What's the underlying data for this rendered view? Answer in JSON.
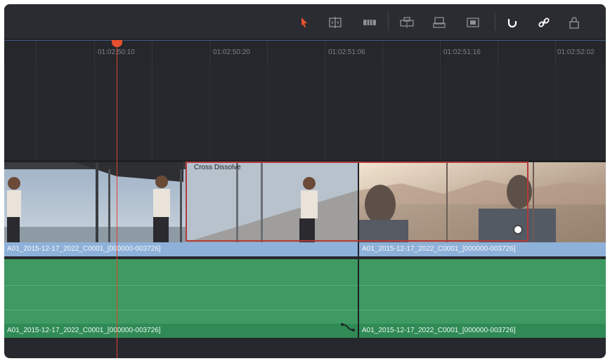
{
  "toolbar": {
    "icons": [
      "selection-pointer-icon",
      "trim-edit-icon",
      "dynamic-trim-icon",
      "blade-icon",
      "insert-clip-icon",
      "overwrite-clip-icon",
      "replace-clip-icon",
      "snapping-magnet-icon",
      "linked-selection-icon",
      "position-lock-icon"
    ],
    "accent_color": "#e6512f"
  },
  "ruler": {
    "timecodes": [
      "01:02:50:10",
      "01:02:50:20",
      "01:02:51:06",
      "01:02:51:16",
      "01:02:52:02"
    ]
  },
  "video_track": {
    "clips": [
      {
        "label": "A01_2015-12-17_2022_C0001_[000000-003726]"
      },
      {
        "label": "A01_2015-12-17_2022_C0001_[000000-003726]"
      }
    ],
    "transition_label": "Cross Dissolve"
  },
  "audio_track": {
    "clips": [
      {
        "label": "A01_2015-12-17_2022_C0001_[000000-003726]"
      },
      {
        "label": "A01_2015-12-17_2022_C0001_[000000-003726]"
      }
    ]
  }
}
